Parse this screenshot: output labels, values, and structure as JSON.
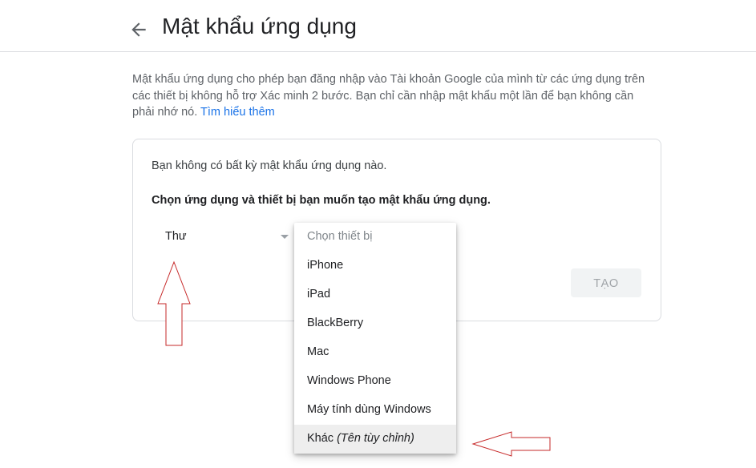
{
  "header": {
    "back_icon": "arrow-left-icon",
    "title": "Mật khẩu ứng dụng"
  },
  "description": {
    "line1": "Mật khẩu ứng dụng cho phép bạn đăng nhập vào Tài khoản Google của mình từ các ứng dụng trên",
    "line2": "các thiết bị không hỗ trợ Xác minh 2 bước. Bạn chỉ cần nhập mật khẩu một lần để bạn không cần",
    "line3": "phải nhớ nó.",
    "learn_more": "Tìm hiểu thêm"
  },
  "card": {
    "empty_message": "Bạn không có bất kỳ mật khẩu ứng dụng nào.",
    "choose_message": "Chọn ứng dụng và thiết bị bạn muốn tạo mật khẩu ứng dụng.",
    "app_select": {
      "value": "Thư",
      "icon": "dropdown-triangle-icon"
    },
    "create_button": "TẠO"
  },
  "device_dropdown": {
    "placeholder": "Chọn thiết bị",
    "options": [
      "iPhone",
      "iPad",
      "BlackBerry",
      "Mac",
      "Windows Phone",
      "Máy tính dùng Windows"
    ],
    "custom_option": {
      "label": "Khác",
      "hint": "(Tên tùy chỉnh)"
    }
  },
  "annotations": {
    "arrow_color": "#c62828",
    "arrows": [
      "up-arrow-annotation",
      "left-arrow-annotation"
    ]
  }
}
